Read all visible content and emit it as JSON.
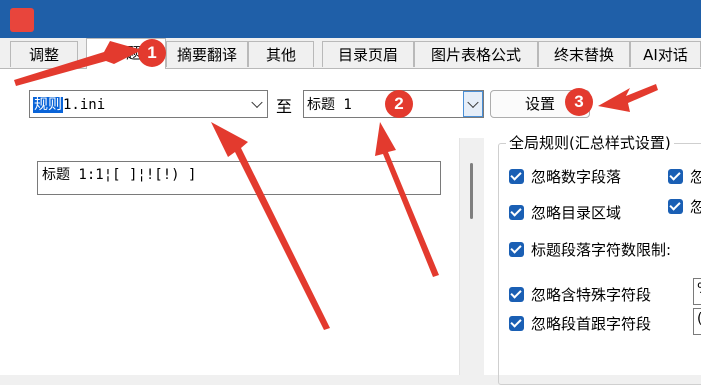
{
  "tabs": [
    "调整",
    "标题",
    "摘要翻译",
    "其他",
    "目录页眉",
    "图片表格公式",
    "终末替换",
    "AI对话"
  ],
  "config_select": {
    "value_selected": "规则",
    "value_rest": "1.ini"
  },
  "to_label": "至",
  "level_select": {
    "value": "标题 1"
  },
  "settings_button": "设置",
  "rule_text": "标题 1:1¦[ ]¦![!) ]",
  "group_title": "全局规则(汇总样式设置)",
  "checkboxes": [
    {
      "label": "忽略数字段落",
      "checked": true
    },
    {
      "label": "忽",
      "checked": true
    },
    {
      "label": "忽略目录区域",
      "checked": true
    },
    {
      "label": "忽",
      "checked": true
    },
    {
      "label": "标题段落字符数限制:",
      "checked": true
    },
    {
      "label": "忽略含特殊字符段",
      "checked": true
    },
    {
      "label": "忽略段首跟字符段",
      "checked": true
    }
  ],
  "mini_fields": [
    "%",
    "("
  ],
  "badges": [
    "1",
    "2",
    "3"
  ],
  "colors": {
    "titlebar": "#1f5fa8",
    "accent": "#1a5fb4",
    "annotation": "#e33a2e"
  }
}
